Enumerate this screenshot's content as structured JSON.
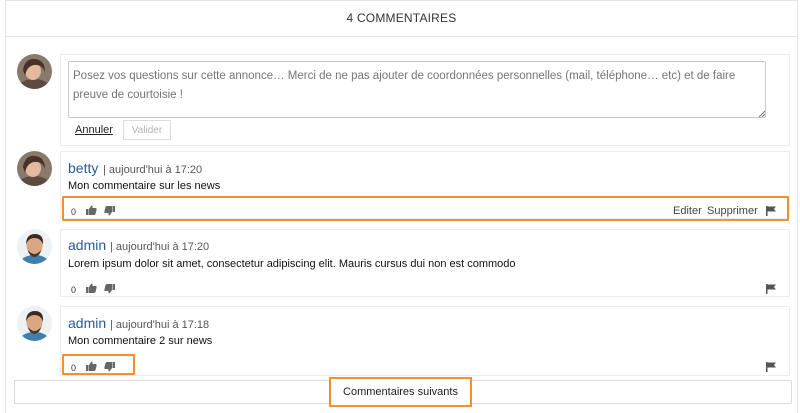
{
  "header": {
    "title": "4 COMMENTAIRES"
  },
  "composer": {
    "placeholder": "Posez vos questions sur cette annonce… Merci de ne pas ajouter de coordonnées personnelles (mail, téléphone… etc) et de faire preuve de courtoisie !",
    "cancel_label": "Annuler",
    "validate_label": "Valider"
  },
  "comments": [
    {
      "author": "betty",
      "separator": "|",
      "date": "aujourd'hui à 17:20",
      "text": "Mon commentaire sur les news",
      "votes": "0",
      "edit_label": "Editer",
      "delete_label": "Supprimer"
    },
    {
      "author": "admin",
      "separator": "|",
      "date": "aujourd'hui à 17:20",
      "text": "Lorem ipsum dolor sit amet, consectetur adipiscing elit. Mauris cursus dui non est commodo",
      "votes": "0"
    },
    {
      "author": "admin",
      "separator": "|",
      "date": "aujourd'hui à 17:18",
      "text": "Mon commentaire 2 sur news",
      "votes": "0"
    }
  ],
  "footer": {
    "more_label": "Commentaires suivants"
  },
  "colors": {
    "accent": "#f3902f",
    "author": "#2a5a96"
  },
  "icons": [
    "thumbs-up-icon",
    "thumbs-down-icon",
    "flag-icon"
  ]
}
